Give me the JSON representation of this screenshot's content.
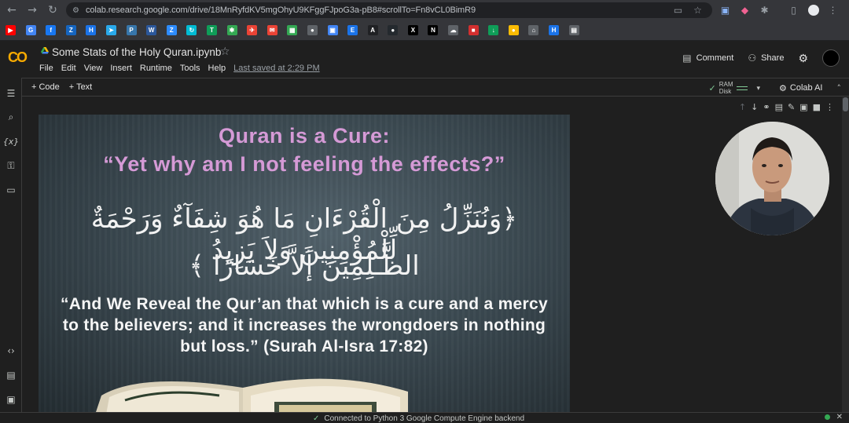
{
  "browser": {
    "url": "colab.research.google.com/drive/18MnRyfdKV5mgOhyU9KFggFJpoG3a-pB8#scrollTo=Fn8vCL0BimR9",
    "bookmarks": [
      {
        "icon": "youtube-icon",
        "color": "#ff0000",
        "glyph": "▶"
      },
      {
        "icon": "translate-icon",
        "color": "#4285f4",
        "glyph": "G"
      },
      {
        "icon": "facebook-icon",
        "color": "#1877f2",
        "glyph": "f"
      },
      {
        "icon": "zotero-icon",
        "color": "#1565c0",
        "glyph": "Z"
      },
      {
        "icon": "h-icon",
        "color": "#1a73e8",
        "glyph": "H"
      },
      {
        "icon": "telegram-icon",
        "color": "#29a9eb",
        "glyph": "➤"
      },
      {
        "icon": "python-icon",
        "color": "#3776ab",
        "glyph": "P"
      },
      {
        "icon": "word-icon",
        "color": "#2b579a",
        "glyph": "W"
      },
      {
        "icon": "zoom-icon",
        "color": "#2d8cff",
        "glyph": "Z"
      },
      {
        "icon": "refresh-icon",
        "color": "#00bcd4",
        "glyph": "↻"
      },
      {
        "icon": "sheets-icon",
        "color": "#0f9d58",
        "glyph": "T"
      },
      {
        "icon": "puzzle-icon",
        "color": "#34a853",
        "glyph": "✱"
      },
      {
        "icon": "bookmark-icon",
        "color": "#ea4335",
        "glyph": "✈"
      },
      {
        "icon": "mail-icon",
        "color": "#ea4335",
        "glyph": "✉"
      },
      {
        "icon": "calendar-icon",
        "color": "#34a853",
        "glyph": "▦"
      },
      {
        "icon": "people-icon",
        "color": "#5f6368",
        "glyph": "●"
      },
      {
        "icon": "photos-icon",
        "color": "#4285f4",
        "glyph": "▣"
      },
      {
        "icon": "e-icon",
        "color": "#1a73e8",
        "glyph": "E"
      },
      {
        "icon": "ai-icon",
        "color": "#202124",
        "glyph": "A"
      },
      {
        "icon": "github-icon",
        "color": "#24292e",
        "glyph": "●"
      },
      {
        "icon": "x-icon",
        "color": "#000000",
        "glyph": "X"
      },
      {
        "icon": "notion-icon",
        "color": "#000000",
        "glyph": "N"
      },
      {
        "icon": "cloud-icon",
        "color": "#5f6368",
        "glyph": "☁"
      },
      {
        "icon": "flag-icon",
        "color": "#d32f2f",
        "glyph": "■"
      },
      {
        "icon": "download-icon",
        "color": "#0f9d58",
        "glyph": "↓"
      },
      {
        "icon": "keep-icon",
        "color": "#fbbc04",
        "glyph": "●"
      },
      {
        "icon": "bank-icon",
        "color": "#5f6368",
        "glyph": "⌂"
      },
      {
        "icon": "h2-icon",
        "color": "#1a73e8",
        "glyph": "H"
      },
      {
        "icon": "docs-icon",
        "color": "#5f6368",
        "glyph": "▤"
      }
    ]
  },
  "notebook": {
    "title": "Some Stats of the Holy Quran.ipynb",
    "menu": [
      "File",
      "Edit",
      "View",
      "Insert",
      "Runtime",
      "Tools",
      "Help"
    ],
    "saved": "Last saved at 2:29 PM",
    "comment": "Comment",
    "share": "Share"
  },
  "toolbar": {
    "code": "+ Code",
    "text": "+ Text",
    "ram": "RAM",
    "disk": "Disk",
    "colab_ai": "Colab AI"
  },
  "slide": {
    "title_line1": "Quran is a Cure:",
    "title_line2": "“Yet why am I not feeling the effects?”",
    "arabic_line1": "﴿وَنُنَزِّلُ مِنَ الْقُرْءَانِ مَا هُوَ شِفَآءٌ وَرَحْمَةٌ لِّلْمُؤْمِنِينَ وَلاَ يَزِيدُ",
    "arabic_line2": "الظَّـلِمِينَ إَلاَّ خَسَارًا ﴾",
    "english_line1": "“And We Reveal the Qur’an that which is a cure and a mercy",
    "english_line2": "to the believers; and it increases the wrongdoers in nothing",
    "english_line3": "but loss.” (Surah Al-Isra 17:82)"
  },
  "status": {
    "text": "Connected to Python 3 Google Compute Engine backend"
  }
}
